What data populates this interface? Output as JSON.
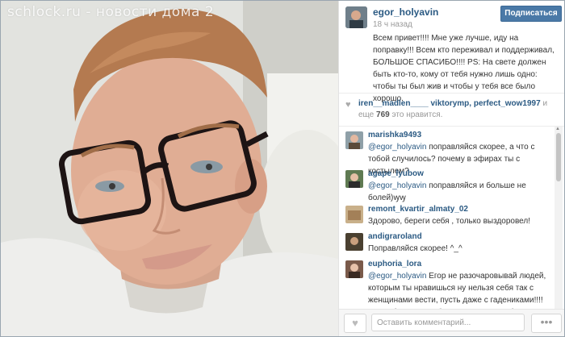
{
  "watermark": "schlock.ru - новости дома 2",
  "post": {
    "username": "egor_holyavin",
    "time_ago": "18 ч назад",
    "follow_label": "Подписаться",
    "caption": "Всем привет!!!! Мне уже лучше, иду на поправку!!! Всем кто переживал и поддерживал, БОЛЬШОЕ СПАСИБО!!!! PS: На свете должен быть кто-то, кому от тебя нужно лишь одно: чтобы ты был жив и чтобы у тебя все было хорошо."
  },
  "likes": {
    "users": "iren__madlen____ viktorymp, perfect_wow1997",
    "and_more": "и еще",
    "count": "769",
    "suffix": "это нравится."
  },
  "comments": [
    {
      "user": "marishka9493",
      "mention": "@egor_holyavin",
      "text": "поправляйся скорее, а что с тобой случилось? почему в эфирах ты с костылем?"
    },
    {
      "user": "agape_lyubow",
      "mention": "@egor_holyavin",
      "text": "поправляйся и больше не болей)ꝡꝡ"
    },
    {
      "user": "remont_kvartir_almaty_02",
      "mention": "",
      "text": "Здорово, береги себя , только выздоровел!"
    },
    {
      "user": "andigraroland",
      "mention": "",
      "text": "Поправляйся скорее! ^_^"
    },
    {
      "user": "euphoria_lora",
      "mention": "@egor_holyavin",
      "text": "Егор не разочаровывай людей, которым ты нравишься ну нельзя себя так с женщинами вести, пусть даже с гадениками!!!! Это тебя не то чтобы не красит, а вообще раскрывает"
    }
  ],
  "footer": {
    "comment_placeholder": "Оставить комментарий...",
    "more_label": "•••"
  },
  "colors": {
    "accent": "#2b5a83",
    "follow_button": "#4a79a7"
  }
}
